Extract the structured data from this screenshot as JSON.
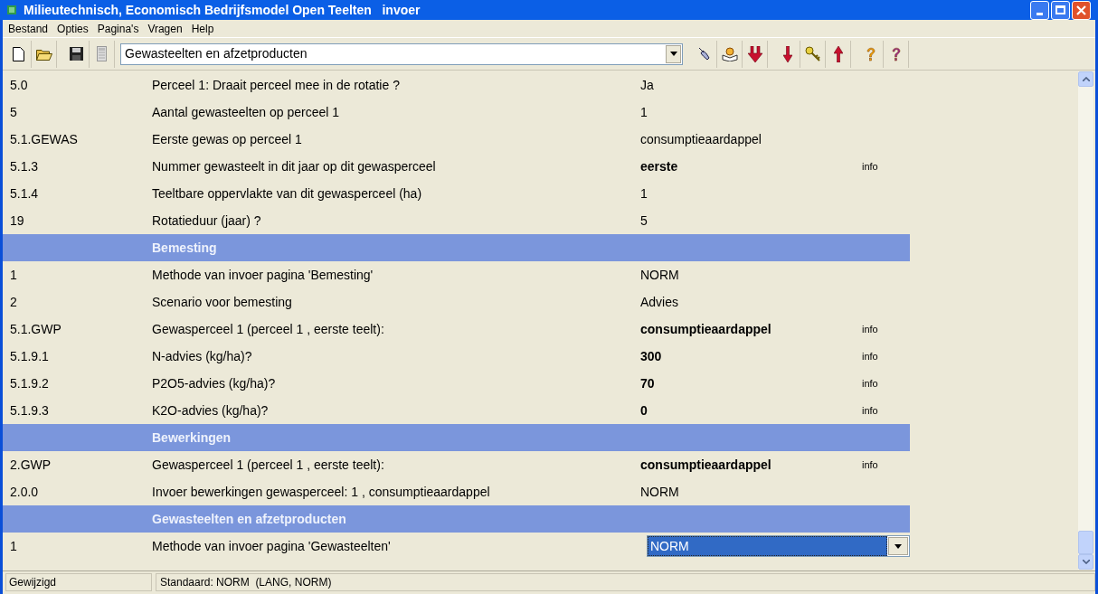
{
  "window": {
    "title": "Milieutechnisch, Economisch Bedrijfsmodel Open Teelten   invoer"
  },
  "menu": [
    "Bestand",
    "Opties",
    "Pagina's",
    "Vragen",
    "Help"
  ],
  "toolbar": {
    "page_select": "Gewasteelten en afzetproducten"
  },
  "rows": [
    {
      "kind": "row",
      "code": "5.0",
      "label": "Perceel 1: Draait perceel mee in de rotatie ?",
      "value": "Ja",
      "bold": false
    },
    {
      "kind": "row",
      "code": "5",
      "label": "Aantal gewasteelten op perceel 1",
      "value": "1",
      "bold": false
    },
    {
      "kind": "row",
      "code": "5.1.GEWAS",
      "label": "Eerste gewas op perceel 1",
      "value": "consumptieaardappel",
      "bold": false
    },
    {
      "kind": "row",
      "code": "5.1.3",
      "label": "Nummer gewasteelt in dit jaar op dit gewasperceel",
      "value": "eerste",
      "bold": true,
      "info": "info"
    },
    {
      "kind": "row",
      "code": "5.1.4",
      "label": "Teeltbare oppervlakte van dit gewasperceel (ha)",
      "value": "1",
      "bold": false
    },
    {
      "kind": "row",
      "code": "19",
      "label": "Rotatieduur (jaar) ?",
      "value": "5",
      "bold": false
    },
    {
      "kind": "header",
      "label": "Bemesting"
    },
    {
      "kind": "row",
      "code": "1",
      "label": "Methode van invoer pagina 'Bemesting'",
      "value": "NORM",
      "bold": false
    },
    {
      "kind": "row",
      "code": "2",
      "label": "Scenario voor bemesting",
      "value": "Advies",
      "bold": false
    },
    {
      "kind": "row",
      "code": "5.1.GWP",
      "label": "Gewasperceel 1 (perceel 1 , eerste teelt):",
      "value": "consumptieaardappel",
      "bold": true,
      "info": "info"
    },
    {
      "kind": "row",
      "code": "5.1.9.1",
      "label": "N-advies (kg/ha)?",
      "value": "300",
      "bold": true,
      "info": "info"
    },
    {
      "kind": "row",
      "code": "5.1.9.2",
      "label": "P2O5-advies (kg/ha)?",
      "value": "70",
      "bold": true,
      "info": "info"
    },
    {
      "kind": "row",
      "code": "5.1.9.3",
      "label": "K2O-advies (kg/ha)?",
      "value": "0",
      "bold": true,
      "info": "info"
    },
    {
      "kind": "header",
      "label": "Bewerkingen"
    },
    {
      "kind": "row",
      "code": "2.GWP",
      "label": "Gewasperceel 1 (perceel 1 , eerste teelt):",
      "value": "consumptieaardappel",
      "bold": true,
      "info": "info"
    },
    {
      "kind": "row",
      "code": "2.0.0",
      "label": "Invoer bewerkingen gewasperceel: 1 , consumptieaardappel",
      "value": "NORM",
      "bold": false
    },
    {
      "kind": "header",
      "label": "Gewasteelten en afzetproducten"
    },
    {
      "kind": "dropdown",
      "code": "1",
      "label": "Methode van invoer pagina 'Gewasteelten'",
      "value": "NORM",
      "selected": true
    }
  ],
  "status_bar": [
    "Gewijzigd",
    "Standaard: NORM  (LANG, NORM)"
  ]
}
